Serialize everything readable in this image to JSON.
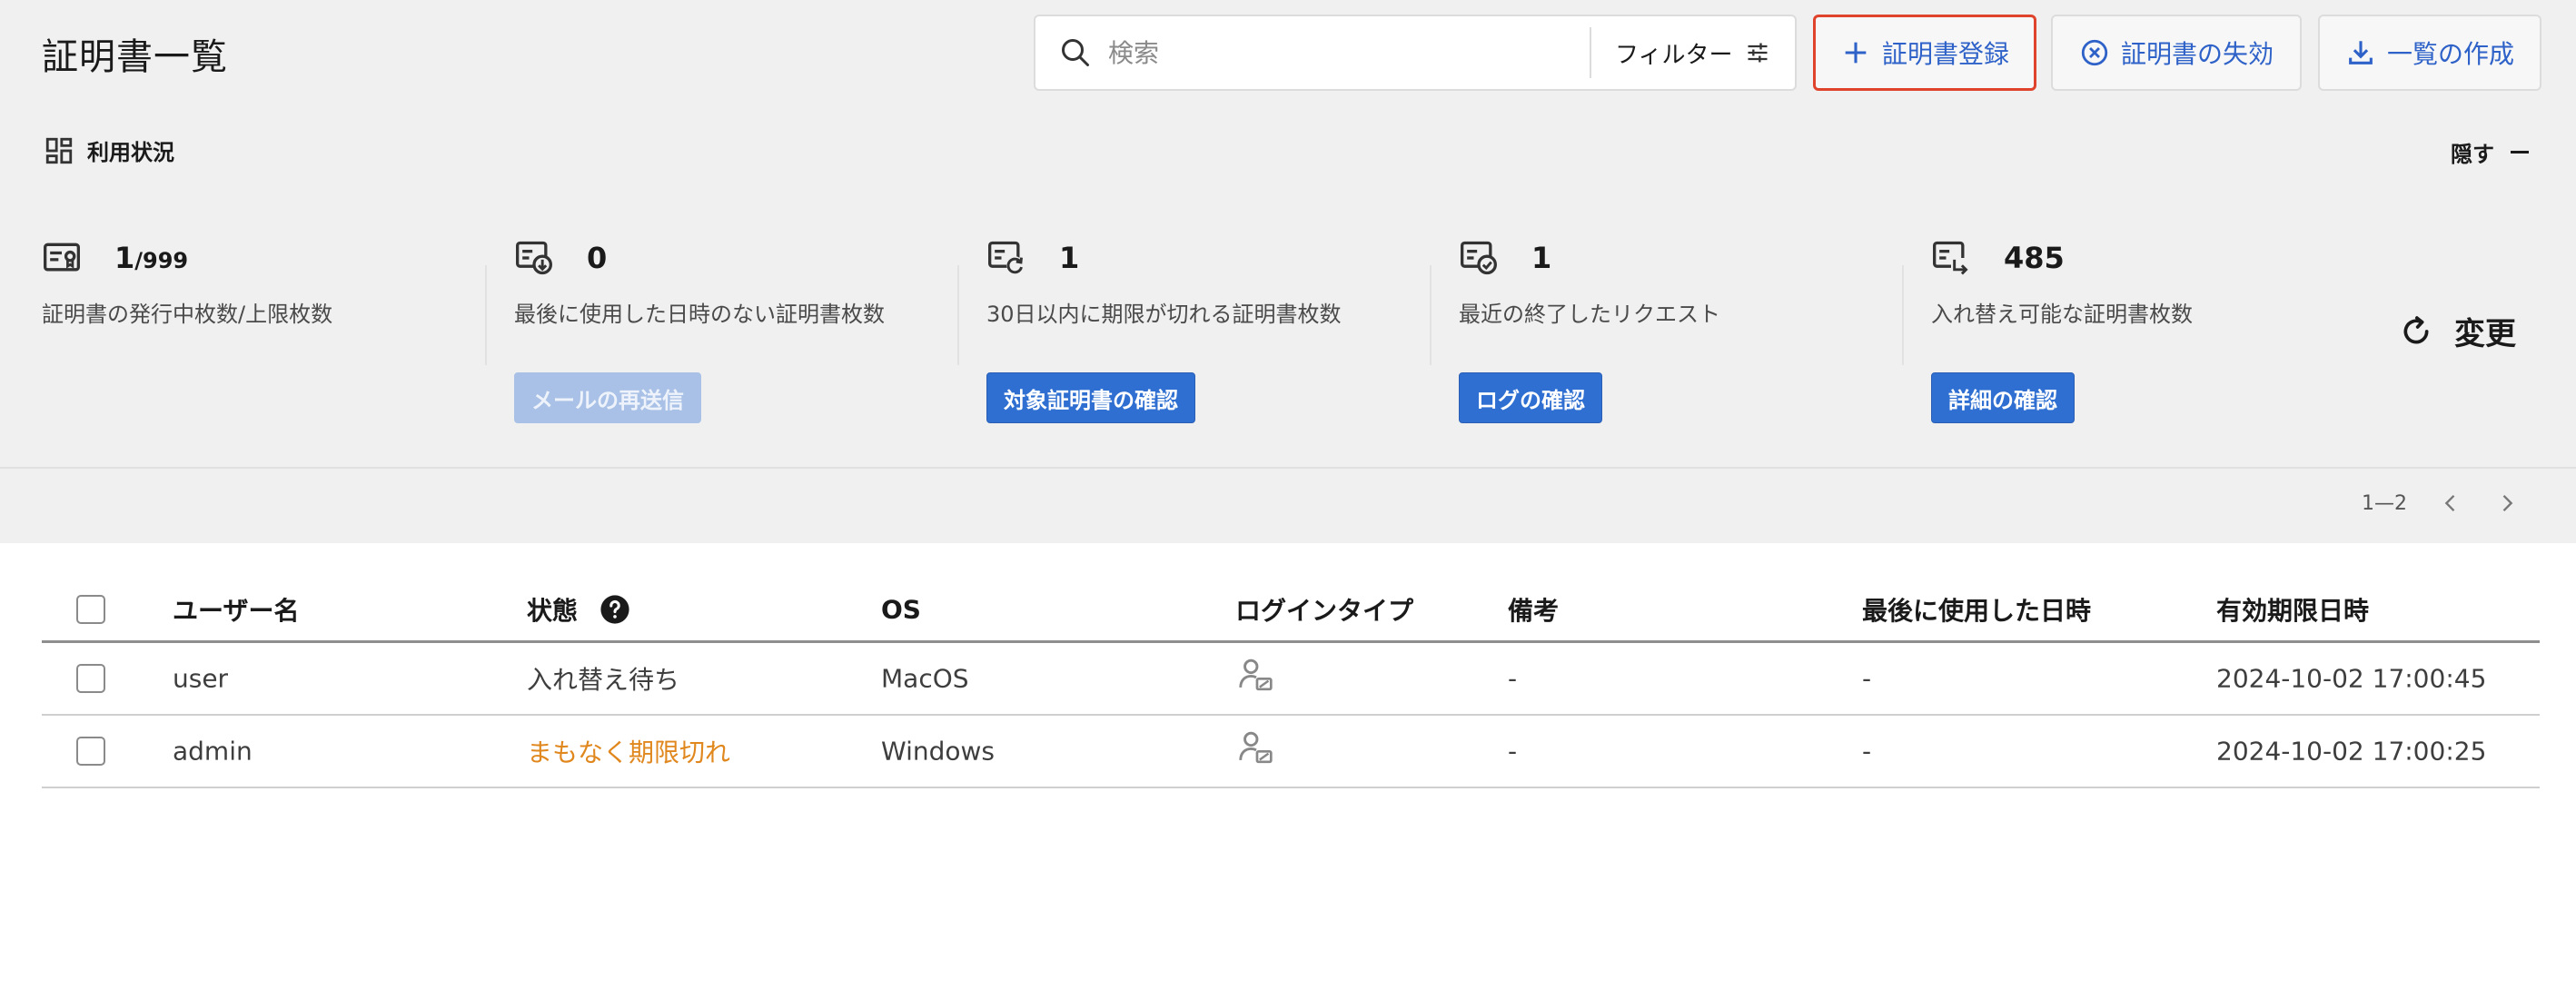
{
  "header": {
    "title": "証明書一覧",
    "search_placeholder": "検索",
    "filter_label": "フィルター",
    "buttons": {
      "register": "証明書登録",
      "revoke": "証明書の失効",
      "export": "一覧の作成"
    }
  },
  "usage": {
    "title": "利用状況",
    "hide_label": "隠す",
    "refresh_label": "変更",
    "stats": [
      {
        "value": "1",
        "value_suffix": "/999",
        "desc": "証明書の発行中枚数/上限枚数",
        "icon": "certificate-icon",
        "button": ""
      },
      {
        "value": "0",
        "value_suffix": "",
        "desc": "最後に使用した日時のない証明書枚数",
        "icon": "certificate-download-icon",
        "button": "メールの再送信"
      },
      {
        "value": "1",
        "value_suffix": "",
        "desc": "30日以内に期限が切れる証明書枚数",
        "icon": "certificate-refresh-icon",
        "button": "対象証明書の確認"
      },
      {
        "value": "1",
        "value_suffix": "",
        "desc": "最近の終了したリクエスト",
        "icon": "certificate-check-icon",
        "button": "ログの確認"
      },
      {
        "value": "485",
        "value_suffix": "",
        "desc": "入れ替え可能な証明書枚数",
        "icon": "certificate-swap-icon",
        "button": "詳細の確認"
      }
    ]
  },
  "pagination": {
    "range": "1—2"
  },
  "table": {
    "columns": {
      "user": "ユーザー名",
      "status": "状態",
      "os": "OS",
      "login_type": "ログインタイプ",
      "note": "備考",
      "last_used": "最後に使用した日時",
      "expires": "有効期限日時"
    },
    "rows": [
      {
        "user": "user",
        "status": "入れ替え待ち",
        "os": "MacOS",
        "note": "-",
        "last_used": "-",
        "expires": "2024-10-02 17:00:45"
      },
      {
        "user": "admin",
        "status": "まもなく期限切れ",
        "os": "Windows",
        "note": "-",
        "last_used": "-",
        "expires": "2024-10-02 17:00:25"
      }
    ]
  },
  "colors": {
    "accent": "#2e62c8",
    "button_primary": "#2e6fd1",
    "highlight_border": "#e0432b",
    "warning": "#e0871e",
    "panel_bg": "#f0f0f0"
  }
}
